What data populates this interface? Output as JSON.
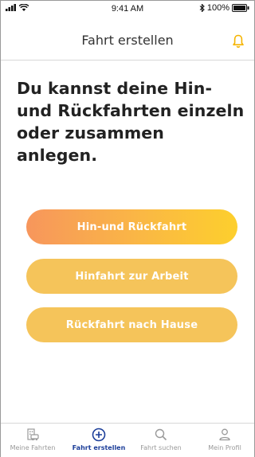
{
  "status_bar": {
    "time": "9:41 AM",
    "battery": "100%"
  },
  "header": {
    "title": "Fahrt erstellen"
  },
  "main": {
    "headline": "Du kannst deine Hin- und Rückfahrten einzeln oder zusammen anlegen.",
    "buttons": [
      {
        "label": "Hin-und Rückfahrt"
      },
      {
        "label": "Hinfahrt zur Arbeit"
      },
      {
        "label": "Rückfahrt nach Hause"
      }
    ]
  },
  "tab_bar": {
    "tabs": [
      {
        "label": "Meine Fahrten",
        "icon": "building-car-icon",
        "active": false
      },
      {
        "label": "Fahrt erstellen",
        "icon": "plus-circle-icon",
        "active": true
      },
      {
        "label": "Fahrt suchen",
        "icon": "search-icon",
        "active": false
      },
      {
        "label": "Mein Profil",
        "icon": "profile-icon",
        "active": false
      }
    ]
  },
  "colors": {
    "accent": "#f5c45a",
    "active_tab": "#1c3e99",
    "bell": "#f5b400"
  }
}
